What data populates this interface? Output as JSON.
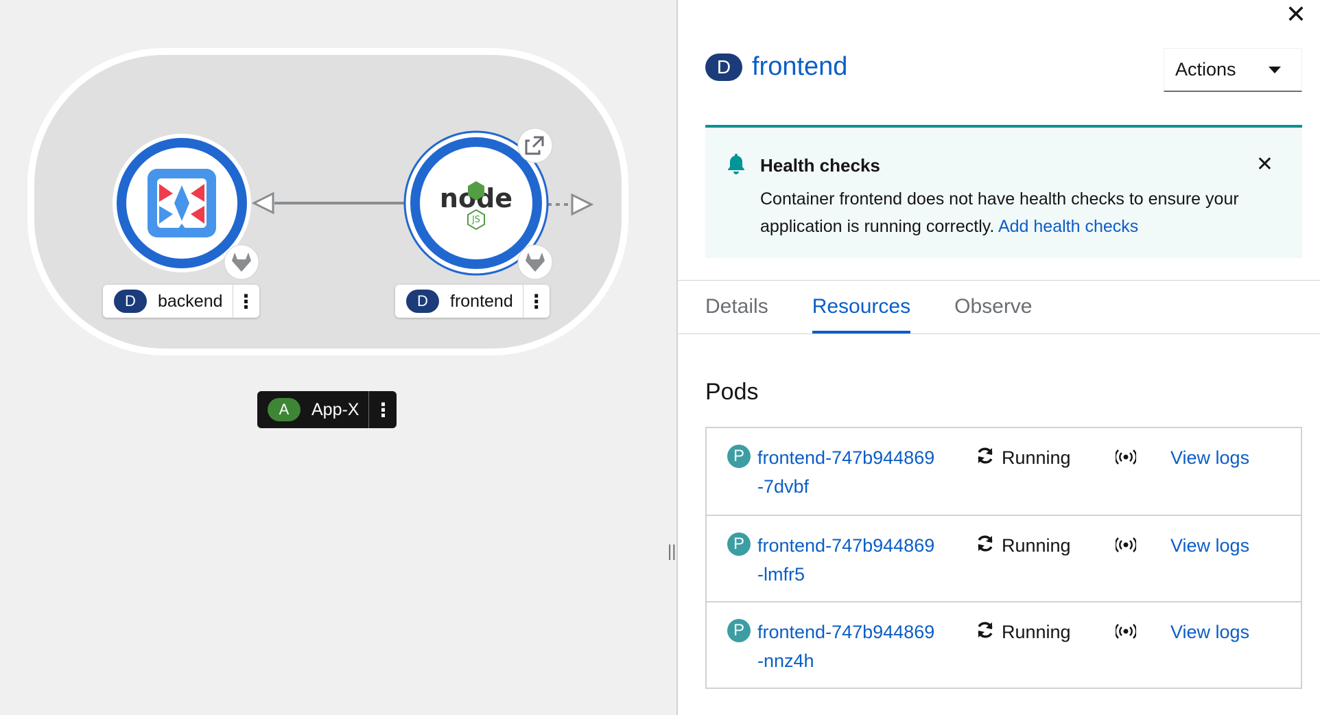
{
  "topology": {
    "application": {
      "badge": "A",
      "name": "App-X"
    },
    "nodes": [
      {
        "id": "backend",
        "badge": "D",
        "name": "backend",
        "icon": "quarkus-icon",
        "decorator": "gitlab-icon"
      },
      {
        "id": "frontend",
        "badge": "D",
        "name": "frontend",
        "icon": "nodejs-icon",
        "decorator": "gitlab-icon",
        "url_decorator": "external-link-icon"
      }
    ],
    "node_label_menu": "⋮"
  },
  "panel": {
    "close": "✕",
    "badge": "D",
    "title": "frontend",
    "actions_label": "Actions",
    "alert": {
      "title": "Health checks",
      "message": "Container frontend does not have health checks to ensure your application is running correctly.",
      "link": "Add health checks",
      "close": "✕"
    },
    "tabs": [
      {
        "label": "Details",
        "active": false
      },
      {
        "label": "Resources",
        "active": true
      },
      {
        "label": "Observe",
        "active": false
      }
    ],
    "pods_title": "Pods",
    "pods": [
      {
        "badge": "P",
        "name": "frontend-747b944869-7dvbf",
        "status": "Running",
        "logs": "View logs"
      },
      {
        "badge": "P",
        "name": "frontend-747b944869-lmfr5",
        "status": "Running",
        "logs": "View logs"
      },
      {
        "badge": "P",
        "name": "frontend-747b944869-nnz4h",
        "status": "Running",
        "logs": "View logs"
      }
    ]
  },
  "colors": {
    "link": "#0b5ec6",
    "deployment_badge": "#1b3b7a",
    "app_badge": "#3e8635",
    "pod_badge": "#3b9ea3",
    "alert_border": "#009596"
  }
}
